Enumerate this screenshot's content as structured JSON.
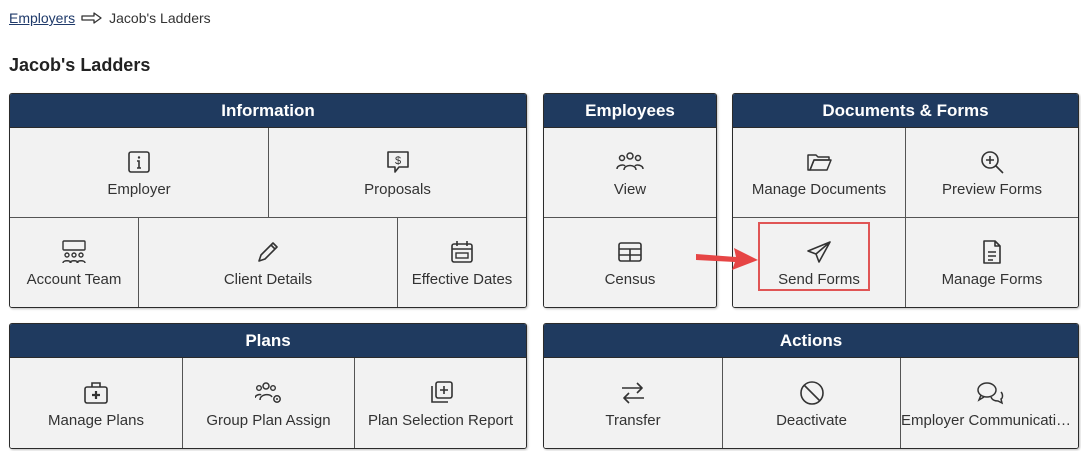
{
  "breadcrumb": {
    "parent": "Employers",
    "current": "Jacob's Ladders"
  },
  "title": "Jacob's Ladders",
  "colors": {
    "header_bg": "#1f3a5f",
    "cell_bg": "#f2f2f2",
    "highlight": "#e05555"
  },
  "information": {
    "title": "Information",
    "employer": "Employer",
    "proposals": "Proposals",
    "account_team": "Account Team",
    "client_details": "Client Details",
    "effective_dates": "Effective Dates"
  },
  "employees": {
    "title": "Employees",
    "view": "View",
    "census": "Census"
  },
  "documents": {
    "title": "Documents & Forms",
    "manage_documents": "Manage Documents",
    "preview_forms": "Preview Forms",
    "send_forms": "Send Forms",
    "manage_forms": "Manage Forms"
  },
  "plans": {
    "title": "Plans",
    "manage_plans": "Manage Plans",
    "group_plan_assign": "Group Plan Assign",
    "plan_selection_report": "Plan Selection Report"
  },
  "actions": {
    "title": "Actions",
    "transfer": "Transfer",
    "deactivate": "Deactivate",
    "employer_communications": "Employer Communications"
  }
}
